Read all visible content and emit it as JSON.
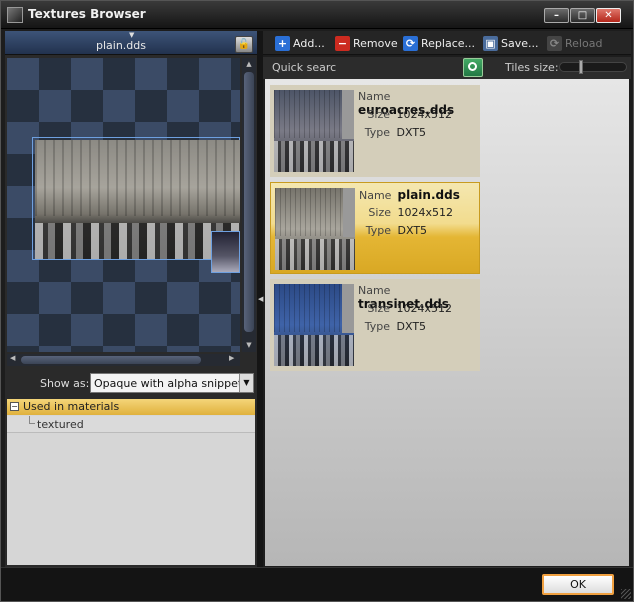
{
  "window": {
    "title": "Textures Browser"
  },
  "preview": {
    "file_name": "plain.dds"
  },
  "show_as": {
    "label": "Show as:",
    "value": "Opaque with alpha snippet"
  },
  "materials": {
    "header": "Used in materials",
    "items": [
      "textured"
    ]
  },
  "toolbar": {
    "add": "Add...",
    "remove": "Remove",
    "replace": "Replace...",
    "save": "Save...",
    "reload": "Reload"
  },
  "search": {
    "label": "Quick search:",
    "value": "",
    "tiles_label": "Tiles size:"
  },
  "tile_labels": {
    "name": "Name",
    "size": "Size",
    "type": "Type"
  },
  "tiles": [
    {
      "name": "euroacres.dds",
      "size": "1024x512",
      "type": "DXT5",
      "selected": false
    },
    {
      "name": "plain.dds",
      "size": "1024x512",
      "type": "DXT5",
      "selected": true
    },
    {
      "name": "transinet.dds",
      "size": "1024x512",
      "type": "DXT5",
      "selected": false
    }
  ],
  "footer": {
    "ok": "OK"
  },
  "colors": {
    "selection": "#e4b634",
    "accent_blue": "#3d5478"
  }
}
